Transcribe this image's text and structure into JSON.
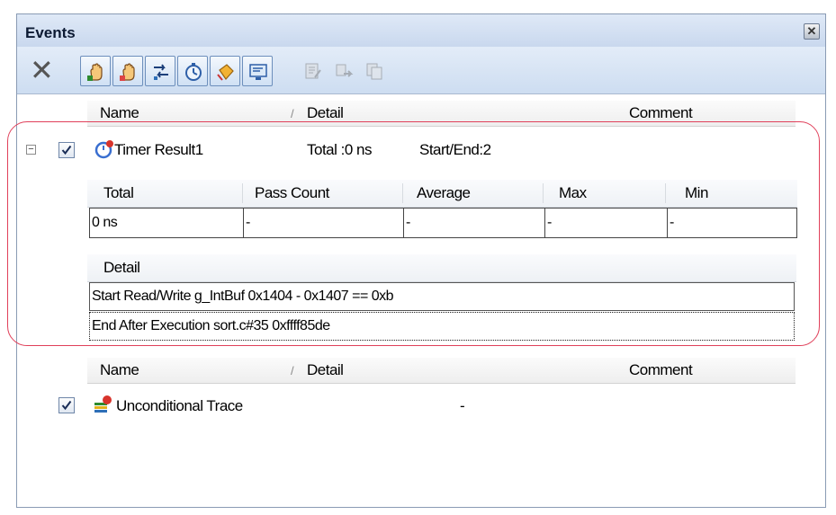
{
  "panel": {
    "title": "Events"
  },
  "toolbar": {
    "delete_icon": "delete-x-icon",
    "buttons": [
      "hardware-break-hand-icon",
      "software-break-hand-icon",
      "trace-icon",
      "timer-icon",
      "point-trace-icon",
      "performance-icon"
    ],
    "disabled_buttons": [
      "edit-icon",
      "move-icon",
      "copy-icon"
    ]
  },
  "columns": {
    "name": "Name",
    "sort_indicator": "/",
    "detail": "Detail",
    "comment": "Comment"
  },
  "timer_event": {
    "expander": "⊟",
    "checked": true,
    "name": "Timer Result1",
    "summary_total": "Total :0 ns",
    "summary_startend": "Start/End:2",
    "stats_headers": {
      "total": "Total",
      "pass_count": "Pass Count",
      "average": "Average",
      "max": "Max",
      "min": "Min"
    },
    "stats_values": {
      "total": "0 ns",
      "pass_count": "-",
      "average": "-",
      "max": "-",
      "min": "-"
    },
    "detail_header": "Detail",
    "details": [
      "Start Read/Write g_IntBuf 0x1404 - 0x1407 == 0xb",
      "End After Execution sort.c#35 0xffff85de"
    ]
  },
  "trace_event": {
    "checked": true,
    "name": "Unconditional Trace",
    "detail": "-"
  },
  "colors": {
    "highlight": "#e0405a",
    "titlebar": "#c9d8ee",
    "toolbar": "#cdddf1"
  }
}
